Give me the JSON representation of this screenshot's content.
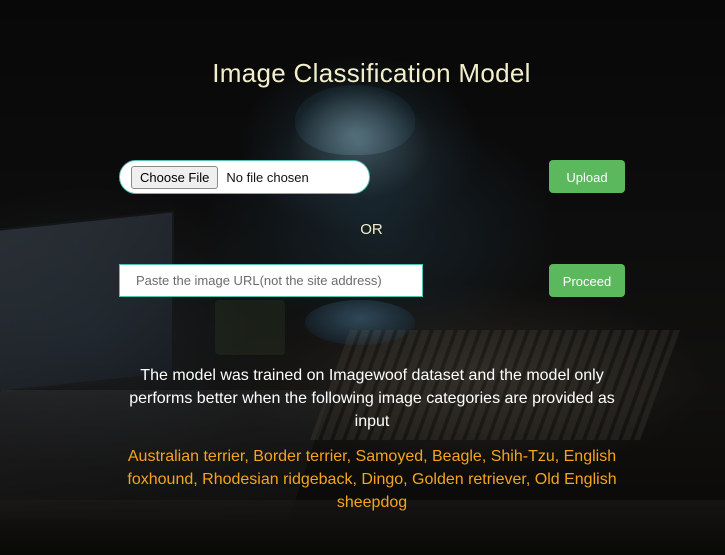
{
  "page": {
    "title": "Image Classification Model"
  },
  "file_upload": {
    "choose_file_label": "Choose File",
    "status_text": "No file chosen",
    "upload_label": "Upload"
  },
  "divider": {
    "or_label": "OR"
  },
  "url_form": {
    "placeholder": "Paste the image URL(not the site address)",
    "value": "",
    "proceed_label": "Proceed"
  },
  "info": {
    "description": "The model was trained on Imagewoof dataset and the model only performs better when the following image categories are provided as input",
    "categories": "Australian terrier, Border terrier, Samoyed, Beagle, Shih-Tzu, English foxhound, Rhodesian ridgeback, Dingo, Golden retriever, Old English sheepdog"
  },
  "colors": {
    "title": "#f3eecb",
    "accent_green": "#5cb85c",
    "input_border": "#4fc3b4",
    "categories": "#f5a41e"
  }
}
